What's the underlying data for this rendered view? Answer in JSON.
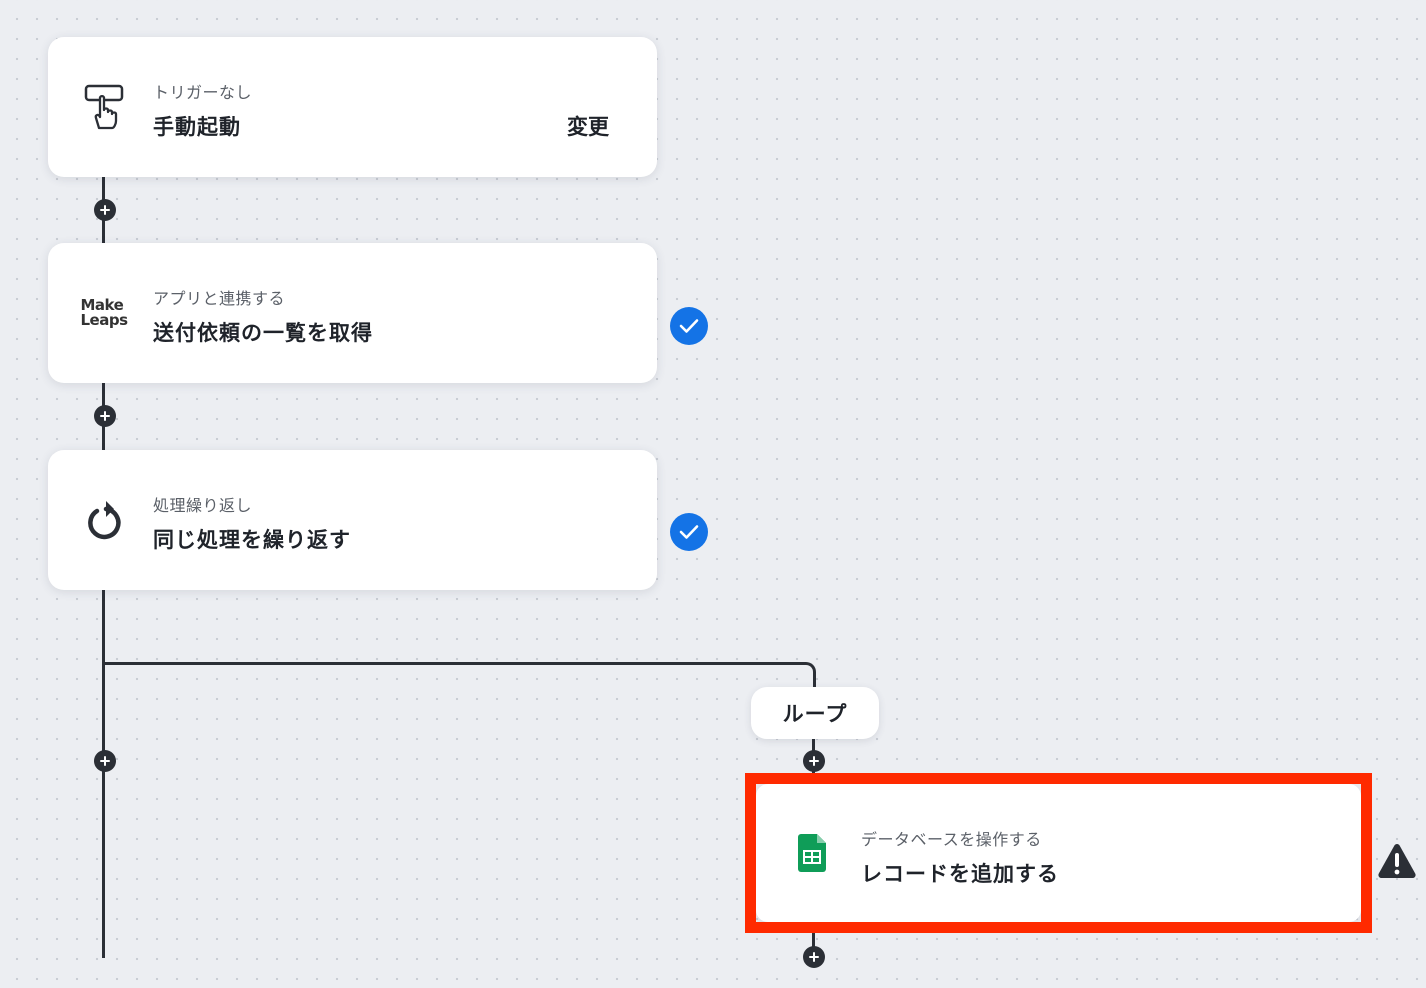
{
  "steps": [
    {
      "subtitle": "トリガーなし",
      "title": "手動起動",
      "action": "変更",
      "icon": "hand-pointer-icon"
    },
    {
      "subtitle": "アプリと連携する",
      "title": "送付依頼の一覧を取得",
      "icon": "makeleaps-logo",
      "logo_line1": "Make",
      "logo_line2": "Leaps",
      "status": "complete"
    },
    {
      "subtitle": "処理繰り返し",
      "title": "同じ処理を繰り返す",
      "icon": "loop-arrow-icon",
      "status": "complete"
    }
  ],
  "loop": {
    "label": "ループ",
    "step": {
      "subtitle": "データベースを操作する",
      "title": "レコードを追加する",
      "icon": "google-sheets-icon",
      "status": "warning"
    }
  },
  "colors": {
    "check": "#1473e6",
    "highlight": "#ff2a00",
    "connector": "#2b2f36",
    "sheets": "#0f9d58"
  }
}
